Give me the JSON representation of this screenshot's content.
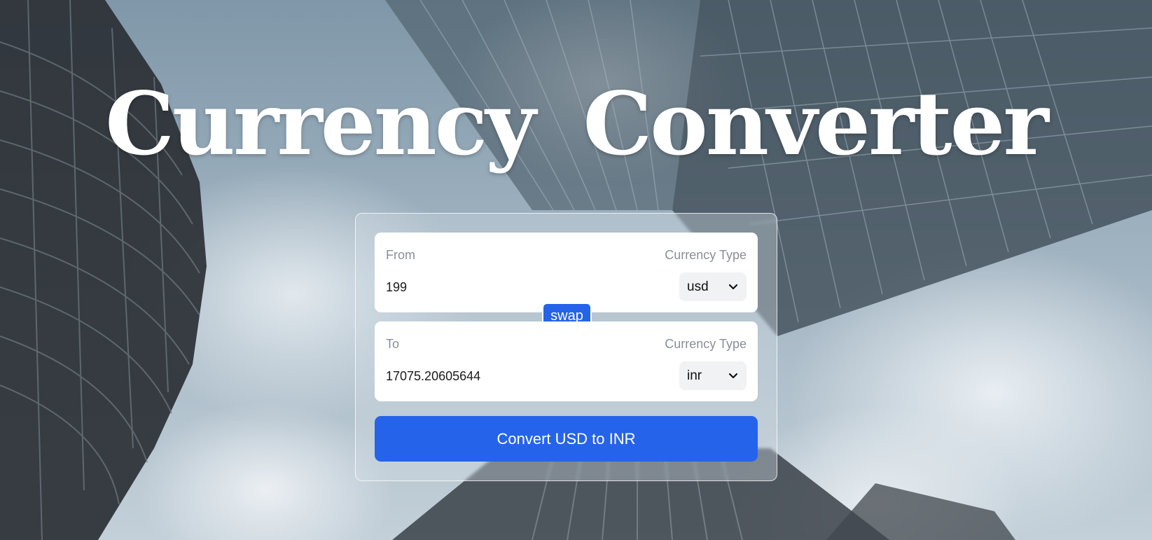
{
  "page": {
    "title": "Currency Converter"
  },
  "from": {
    "label": "From",
    "currency_label": "Currency Type",
    "amount": "199",
    "currency": "usd"
  },
  "to": {
    "label": "To",
    "currency_label": "Currency Type",
    "amount": "17075.20605644",
    "currency": "inr"
  },
  "swap_label": "swap",
  "convert_label": "Convert USD to INR",
  "colors": {
    "accent": "#2563eb",
    "panel": "#ffffff",
    "label_text": "#8a8f98"
  }
}
